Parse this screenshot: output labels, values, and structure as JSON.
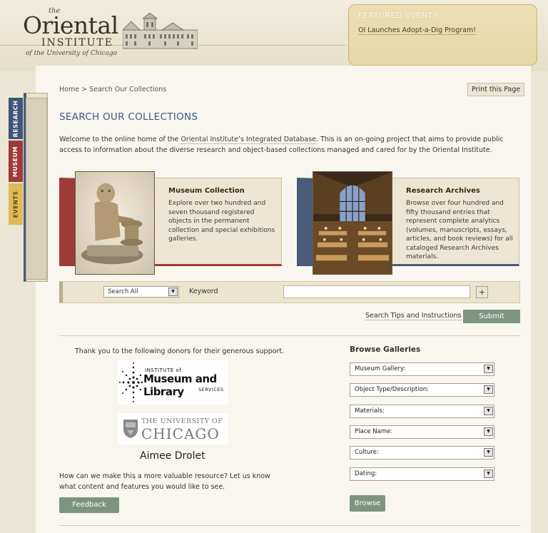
{
  "header": {
    "logo_the": "the",
    "logo_main": "Oriental",
    "logo_institute": "INSTITUTE",
    "logo_university": "of the University of Chicago"
  },
  "featured": {
    "title": "FEATURED EVENTS",
    "link": "OI Launches Adopt-a-Dig Program!"
  },
  "side_tabs": {
    "research": "RESEARCH",
    "museum": "MUSEUM",
    "events": "EVENTS"
  },
  "breadcrumb": {
    "home": "Home",
    "separator": ">",
    "current": "Search Our Collections"
  },
  "print_label": "Print this Page",
  "page_title": "SEARCH OUR COLLECTIONS",
  "intro": {
    "before": "Welcome to the online home of the ",
    "link": "Oriental Institute’s Integrated Database",
    "after": ". This is an on-going project that aims to provide public access to information about the diverse research and object-based collections managed and cared for by the Oriental Institute."
  },
  "cards": {
    "museum": {
      "title": "Museum Collection",
      "text": "Explore over two hundred and seven thousand registered objects in the permanent collection and special exhibitions galleries."
    },
    "archives": {
      "title": "Research Archives",
      "text": "Browse over four hundred and fifty thousand entries that represent complete analytics (volumes, manuscripts, essays, articles, and book reviews) for all cataloged Research Archives materials."
    }
  },
  "search": {
    "scope_value": "Search All",
    "keyword_label": "Keyword",
    "keyword_value": "",
    "plus_label": "+",
    "tips_link": "Search Tips and Instructions",
    "submit_label": "Submit"
  },
  "donors": {
    "thanks": "Thank you to the following donors for their generous support.",
    "imls_line1": "INSTITUTE of",
    "imls_line2": "Museum and Library",
    "imls_line3": "SERVICES",
    "uc_line1": "THE UNIVERSITY OF",
    "uc_line2": "CHICAGO",
    "name": "Aimee Drolet"
  },
  "feedback": {
    "ask": "How can we make this a more valuable resource? Let us know what content and features you would like to see.",
    "button": "Feedback"
  },
  "browse": {
    "title": "Browse Galleries",
    "selects": [
      "Museum Gallery:",
      "Object Type/Description:",
      "Materials:",
      "Place Name:",
      "Culture:",
      "Dating:"
    ],
    "button": "Browse"
  },
  "colors": {
    "research_tab": "#3f5478",
    "museum_tab": "#9e3a38",
    "events_tab": "#e1ba57",
    "button_green": "#7d9481",
    "title_blue": "#3d5a84"
  },
  "icons": {
    "dropdown": "chevron-down-icon",
    "plus": "plus-icon"
  }
}
